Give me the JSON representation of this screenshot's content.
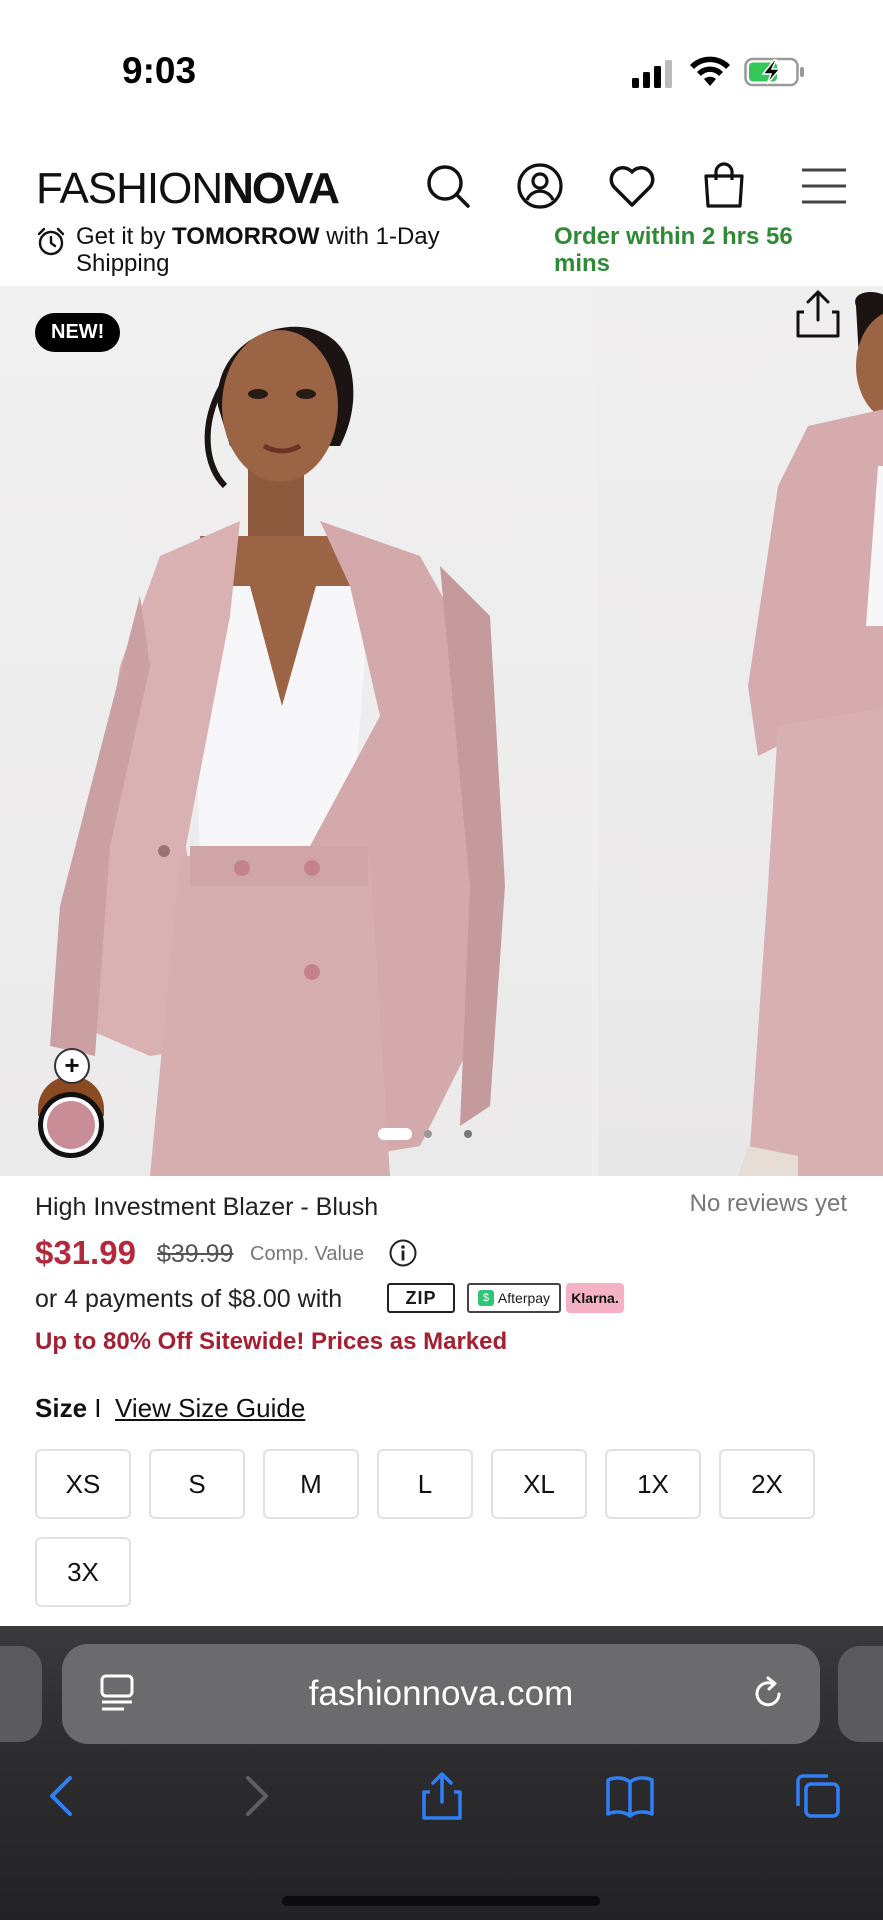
{
  "status_bar": {
    "time": "9:03",
    "icons": [
      "signal-icon",
      "wifi-icon",
      "battery-charging-icon"
    ]
  },
  "header": {
    "logo_light": "FASHION",
    "logo_bold": "NOVA",
    "icons": [
      "search-icon",
      "account-icon",
      "wishlist-heart-icon",
      "shopping-bag-icon",
      "menu-icon"
    ]
  },
  "delivery": {
    "prefix": "Get it by ",
    "highlight": "TOMORROW",
    "suffix": " with 1-Day Shipping",
    "order_within": "Order within 2 hrs 56 mins"
  },
  "gallery": {
    "badge": "NEW!",
    "swatch_plus": "+",
    "swatch_color": "#c98d98",
    "slide_count": 3,
    "active_slide": 1
  },
  "product": {
    "name": "High Investment Blazer - Blush",
    "reviews": "No reviews yet",
    "price": "$31.99",
    "compare_price": "$39.99",
    "compare_label": "Comp. Value",
    "payments_text": "or 4 payments of $8.00 with",
    "zip_label": "ZIP",
    "afterpay_label": "Afterpay",
    "klarna_label": "Klarna.",
    "promo": "Up to 80% Off Sitewide! Prices as Marked"
  },
  "size": {
    "label": "Size",
    "separator": " I ",
    "guide_link": "View Size Guide",
    "options": [
      "XS",
      "S",
      "M",
      "L",
      "XL",
      "1X",
      "2X",
      "3X"
    ]
  },
  "browser": {
    "url": "fashionnova.com",
    "toolbar": [
      "back-icon",
      "forward-icon",
      "share-icon",
      "bookmarks-icon",
      "tabs-icon"
    ]
  },
  "colors": {
    "price_red": "#b5283b",
    "promo_red": "#a31f31",
    "delivery_green": "#2f8a36",
    "ios_blue": "#2f7ff6"
  }
}
